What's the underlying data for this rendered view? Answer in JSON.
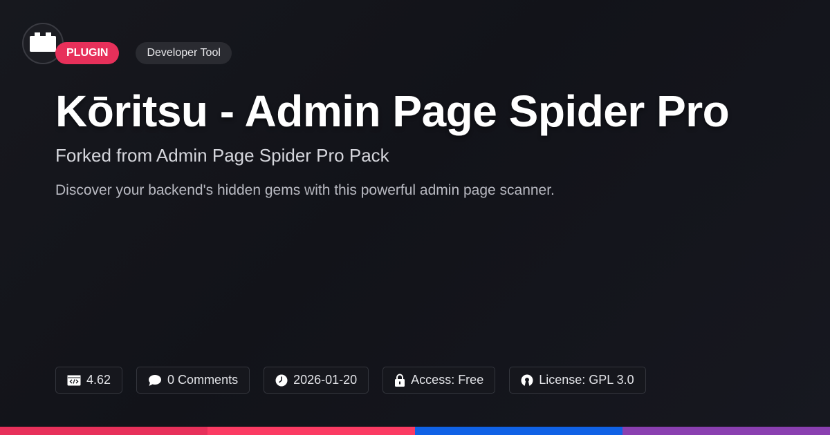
{
  "badges": {
    "type": "PLUGIN",
    "category": "Developer Tool"
  },
  "title": "Kōritsu - Admin Page Spider Pro",
  "subtitle": "Forked from Admin Page Spider Pro Pack",
  "description": "Discover your backend's hidden gems with this powerful admin page scanner.",
  "meta": {
    "version": "4.62",
    "comments": "0 Comments",
    "date": "2026-01-20",
    "access": "Access: Free",
    "license": "License: GPL 3.0"
  },
  "icons": {
    "logo": "plugin-block-icon",
    "version": "code-icon",
    "comments": "comment-bubble-icon",
    "date": "clock-icon",
    "access": "lock-icon",
    "license": "open-source-icon"
  },
  "colors": {
    "accent_plugin": "#e7305a",
    "bar": [
      "#e7305a",
      "#fb3b63",
      "#1062e6",
      "#8a3fb0"
    ]
  }
}
